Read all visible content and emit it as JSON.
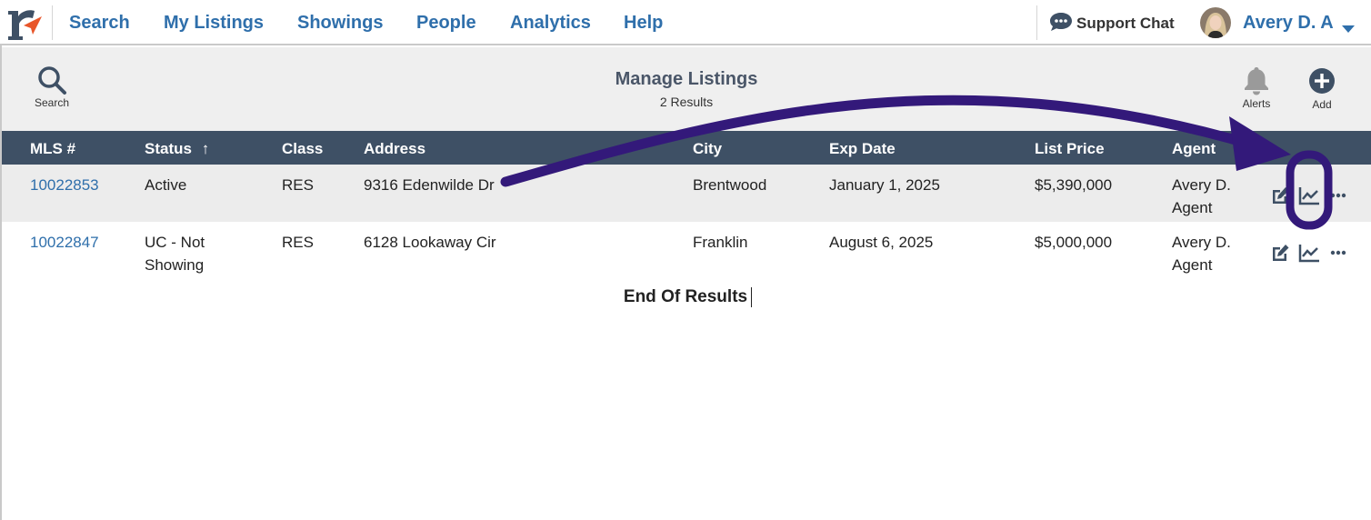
{
  "nav": {
    "items": [
      {
        "label": "Search"
      },
      {
        "label": "My Listings"
      },
      {
        "label": "Showings"
      },
      {
        "label": "People"
      },
      {
        "label": "Analytics"
      },
      {
        "label": "Help"
      }
    ],
    "support_label": "Support Chat",
    "user_name": "Avery D. A"
  },
  "toolbar": {
    "search_label": "Search",
    "title": "Manage Listings",
    "subtitle": "2 Results",
    "alerts_label": "Alerts",
    "add_label": "Add"
  },
  "table": {
    "headers": {
      "mls": "MLS #",
      "status": "Status",
      "status_sort": "↑",
      "class": "Class",
      "address": "Address",
      "city": "City",
      "exp_date": "Exp Date",
      "list_price": "List Price",
      "agent": "Agent"
    },
    "rows": [
      {
        "mls": "10022853",
        "status": "Active",
        "class": "RES",
        "address": "9316 Edenwilde Dr",
        "city": "Brentwood",
        "exp_date": "January 1, 2025",
        "list_price": "$5,390,000",
        "agent": "Avery D. Agent"
      },
      {
        "mls": "10022847",
        "status": "UC - Not Showing",
        "class": "RES",
        "address": "6128 Lookaway Cir",
        "city": "Franklin",
        "exp_date": "August 6, 2025",
        "list_price": "$5,000,000",
        "agent": "Avery D. Agent"
      }
    ]
  },
  "end_text": "End Of Results",
  "icons": {
    "logo": "r-logo-icon",
    "search": "search-icon",
    "alerts": "bell-icon",
    "add": "plus-circle-icon",
    "support": "chat-bubble-icon",
    "edit": "edit-icon",
    "analytics": "chart-line-icon",
    "more": "more-dots-icon"
  },
  "colors": {
    "brand_blue": "#2f6fab",
    "header_bg": "#3e5065",
    "logo_orange": "#e8562a",
    "annotation_purple": "#33197a"
  }
}
